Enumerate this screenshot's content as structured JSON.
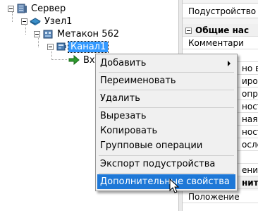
{
  "tree": {
    "items": [
      {
        "label": "Сервер",
        "icon": "server-icon"
      },
      {
        "label": "Узел1",
        "icon": "node-icon"
      },
      {
        "label": "Метакон 562",
        "icon": "device-icon"
      },
      {
        "label": "Канал1",
        "icon": "channel-icon"
      },
      {
        "label": "Вх",
        "icon": "green-arrow-icon"
      }
    ]
  },
  "properties": {
    "header": "Подустройство",
    "group_general": "Общие нас",
    "row_comment": "Комментари",
    "fragments": [
      "но в",
      "ироват",
      "опро",
      "ност",
      "ная с",
      "ност",
      "осле"
    ],
    "row_bottom_a": "ение",
    "group_bottom": "ните",
    "row_position": "Положение"
  },
  "context_menu": {
    "add": "Добавить",
    "rename": "Переименовать",
    "delete": "Удалить",
    "cut": "Вырезать",
    "copy": "Копировать",
    "group_ops": "Групповые операции",
    "export": "Экспорт подустройства",
    "extra_props": "Дополнительные свойства"
  },
  "colors": {
    "selection": "#3399ff",
    "menu_highlight": "#1e78d7",
    "menu_bg": "#f0f0f0"
  }
}
